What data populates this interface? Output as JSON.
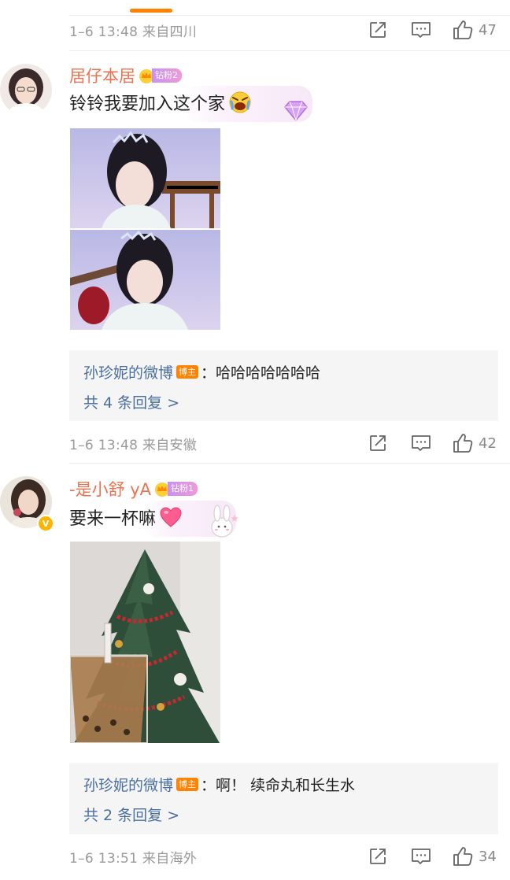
{
  "comments": [
    {
      "meta": {
        "info": "1–6 13:48 来自四川",
        "likes": "47"
      }
    },
    {
      "user": {
        "name": "居仔本居",
        "fan_level": "钻粉2"
      },
      "text": "铃铃我要加入这个家",
      "replies": {
        "name": "孙珍妮的微博",
        "tag": "博主",
        "text": "：哈哈哈哈哈哈哈",
        "more": "共 4 条回复 >"
      },
      "meta": {
        "info": "1–6 13:48 来自安徽",
        "likes": "42"
      }
    },
    {
      "user": {
        "name": "-是小舒 yA",
        "fan_level": "钻粉1"
      },
      "text": "要来一杯嘛",
      "replies": {
        "name": "孙珍妮的微博",
        "tag": "博主",
        "text": "：啊！ 续命丸和长生水",
        "more": "共 2 条回复 >"
      },
      "meta": {
        "info": "1–6 13:51 来自海外",
        "likes": "34"
      }
    }
  ],
  "colors": {
    "accent": "#ff8200",
    "username": "#eb7350",
    "link": "#4a6ea0",
    "meta": "#9a9a9a"
  },
  "icons": [
    "share-icon",
    "comment-icon",
    "like-icon",
    "crown-icon",
    "verified-icon"
  ]
}
